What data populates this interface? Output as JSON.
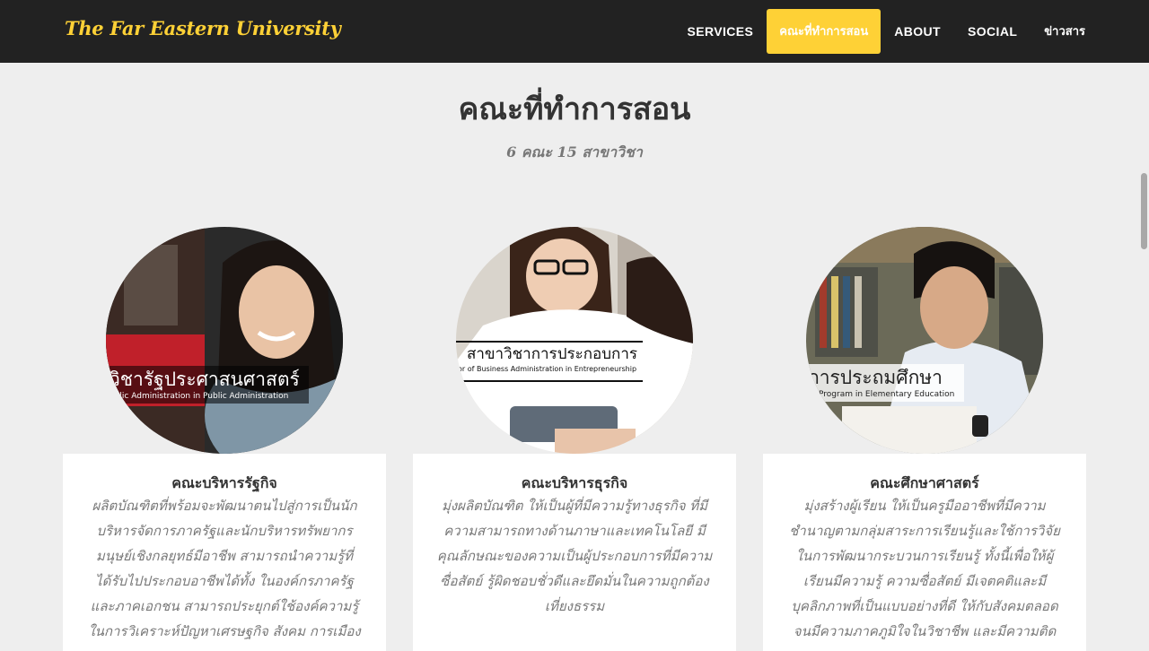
{
  "navbar": {
    "brand": "The Far Eastern University",
    "items": [
      {
        "label": "SERVICES"
      },
      {
        "label": "คณะที่ทำการสอน"
      },
      {
        "label": "ABOUT"
      },
      {
        "label": "SOCIAL"
      },
      {
        "label": "ข่าวสาร"
      }
    ]
  },
  "section": {
    "heading": "คณะที่ทำการสอน",
    "subheading": "6 คณะ 15 สาขาวิชา"
  },
  "faculties": [
    {
      "image_title": "วิชารัฐประศาสนศาสตร์",
      "image_subtitle": "ublic Administration in Public Administration",
      "name": "คณะบริหารรัฐกิจ",
      "lines": [
        "ผลิตบัณฑิตที่พร้อมจะพัฒนาตนไปสู่การเป็นนัก",
        "บริหารจัดการภาครัฐและนักบริหารทรัพยากร",
        "มนุษย์เชิงกลยุทธ์มีอาชีพ สามารถนำความรู้ที่",
        "ได้รับไปประกอบอาชีพได้ทั้ง ในองค์กรภาครัฐ",
        "และภาคเอกชน สามารถประยุกต์ใช้องค์ความรู้",
        "ในการวิเคราะห์ปัญหาเศรษฐกิจ สังคม การเมือง"
      ]
    },
    {
      "image_title": "สาขาวิชาการประกอบการ",
      "image_subtitle": "or of Business Administration in Entrepreneurship",
      "name": "คณะบริหารธุรกิจ",
      "lines": [
        "มุ่งผลิตบัณฑิต ให้เป็นผู้ที่มีความรู้ทางธุรกิจ ที่มี",
        "ความสามารถทางด้านภาษาและเทคโนโลยี มี",
        "คุณลักษณะของความเป็นผู้ประกอบการที่มีความ",
        "ซื่อสัตย์ รู้ผิดชอบชั่วดีและยึดมั่นในความถูกต้อง",
        "เที่ยงธรรม"
      ]
    },
    {
      "image_title": "การประถมศึกษา",
      "image_subtitle": "Program in Elementary Education",
      "name": "คณะศึกษาศาสตร์",
      "lines": [
        "มุ่งสร้างผู้เรียน ให้เป็นครูมืออาชีพที่มีความ",
        "ชำนาญตามกลุ่มสาระการเรียนรู้และใช้การวิจัย",
        "ในการพัฒนากระบวนการเรียนรู้ ทั้งนี้เพื่อให้ผู้",
        "เรียนมีความรู้ ความซื่อสัตย์ มีเจตคติและมี",
        "บุคลิกภาพที่เป็นแบบอย่างที่ดี ให้กับสังคมตลอด",
        "จนมีความภาคภูมิใจในวิชาชีพ และมีความติด"
      ]
    }
  ],
  "colors": {
    "accent": "#fed136",
    "navbar": "#222222",
    "background": "#eeeeee"
  }
}
